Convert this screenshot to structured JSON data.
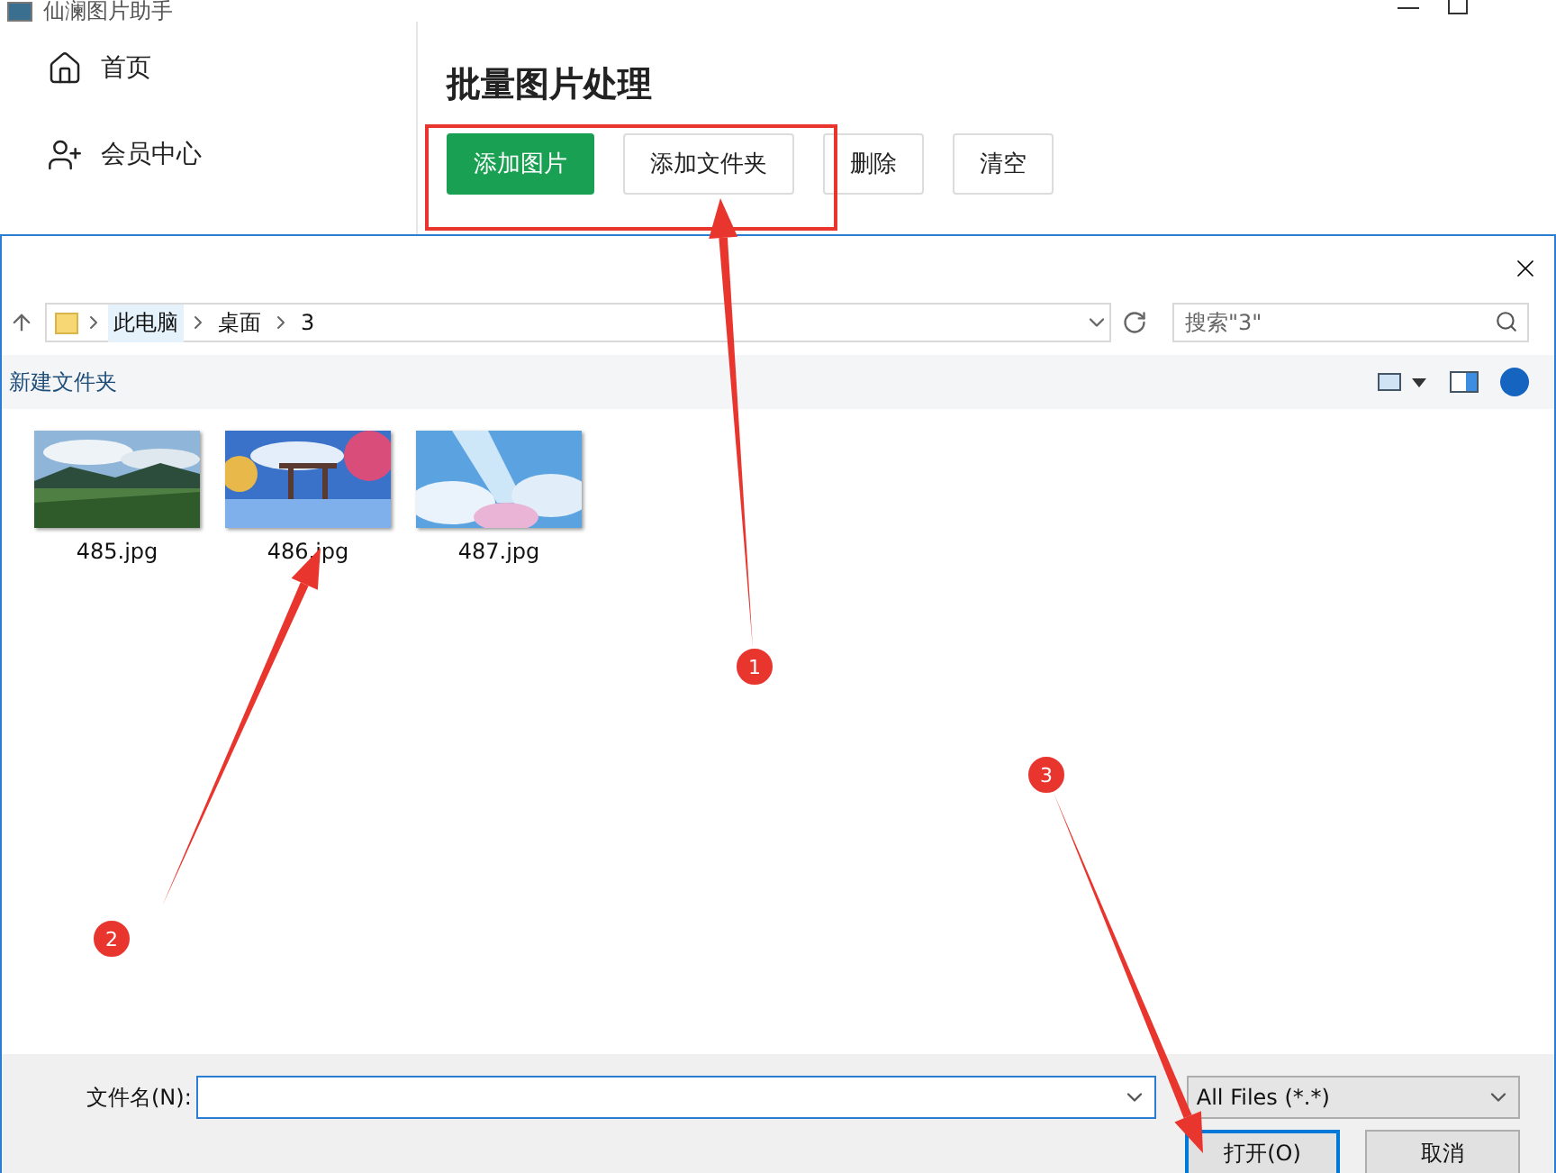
{
  "window": {
    "title": "仙澜图片助手"
  },
  "sidebar": {
    "items": [
      {
        "label": "首页",
        "kind": "home"
      },
      {
        "label": "会员中心",
        "kind": "user"
      }
    ]
  },
  "page": {
    "title": "批量图片处理",
    "buttons": [
      {
        "label": "添加图片",
        "primary": true
      },
      {
        "label": "添加文件夹",
        "primary": false
      },
      {
        "label": "删除",
        "primary": false
      },
      {
        "label": "清空",
        "primary": false
      }
    ]
  },
  "dialog": {
    "breadcrumb": [
      {
        "label": "此电脑",
        "selected": true
      },
      {
        "label": "桌面",
        "selected": false
      },
      {
        "label": "3",
        "selected": false
      }
    ],
    "search": {
      "placeholder": "搜索\"3\""
    },
    "new_folder": "新建文件夹",
    "files": [
      {
        "name": "485.jpg",
        "kind": "picture"
      },
      {
        "name": "486.jpg",
        "kind": "picture"
      },
      {
        "name": "487.jpg",
        "kind": "picture"
      }
    ],
    "file_name_label": "文件名(N):",
    "file_type": "All Files (*.*)",
    "buttons": [
      {
        "label": "打开(O)",
        "primary": true
      },
      {
        "label": "取消",
        "primary": false
      }
    ]
  },
  "annotations": [
    {
      "label": "1"
    },
    {
      "label": "2"
    },
    {
      "label": "3"
    }
  ]
}
